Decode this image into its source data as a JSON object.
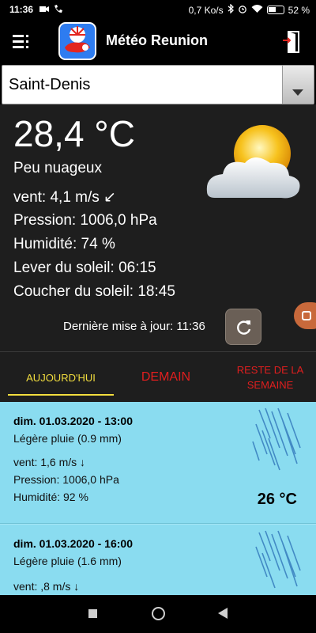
{
  "status_bar": {
    "time": "11:36",
    "network_speed": "0,7 Ko/s",
    "battery": "52 %",
    "icons": [
      "video-icon",
      "phone-icon",
      "bluetooth-icon",
      "alarm-icon",
      "wifi-icon",
      "battery-icon"
    ]
  },
  "app_bar": {
    "title": "Météo Reunion",
    "icons": [
      "menu-icon",
      "app-logo",
      "exit-door-icon"
    ]
  },
  "location_select": {
    "value": "Saint-Denis"
  },
  "current": {
    "temperature": "28,4 °C",
    "condition": "Peu nuageux",
    "wind": "vent: 4,1 m/s ↙",
    "pressure": "Pression: 1006,0 hPa",
    "humidity": "Humidité: 74 %",
    "sunrise": "Lever du soleil: 06:15",
    "sunset": "Coucher du soleil: 18:45",
    "last_update": "Dernière mise à jour: 11:36",
    "icon": "sun-cloud-icon"
  },
  "tabs": [
    {
      "label": "AUJOURD'HUI",
      "active": true,
      "color": "#f2dd3e"
    },
    {
      "label": "DEMAIN",
      "active": false,
      "color": "#e01e1e"
    },
    {
      "label": "RESTE DE LA SEMAINE",
      "active": false,
      "color": "#e01e1e"
    }
  ],
  "forecasts": [
    {
      "title": "dim. 01.03.2020 - 13:00",
      "description": "Légère pluie (0.9 mm)",
      "wind": "vent: 1,6 m/s ↓",
      "pressure": "Pression: 1006,0 hPa",
      "humidity": "Humidité: 92 %",
      "temperature": "26 °C",
      "icon": "rain-icon"
    },
    {
      "title": "dim. 01.03.2020 - 16:00",
      "description": "Légère pluie (1.6 mm)",
      "wind": "vent: ,8 m/s ↓",
      "icon": "rain-icon"
    }
  ],
  "colors": {
    "panel": "#1e1e1e",
    "list_background": "#8adcf0",
    "active_tab": "#f2dd3e",
    "inactive_tab": "#e01e1e"
  }
}
